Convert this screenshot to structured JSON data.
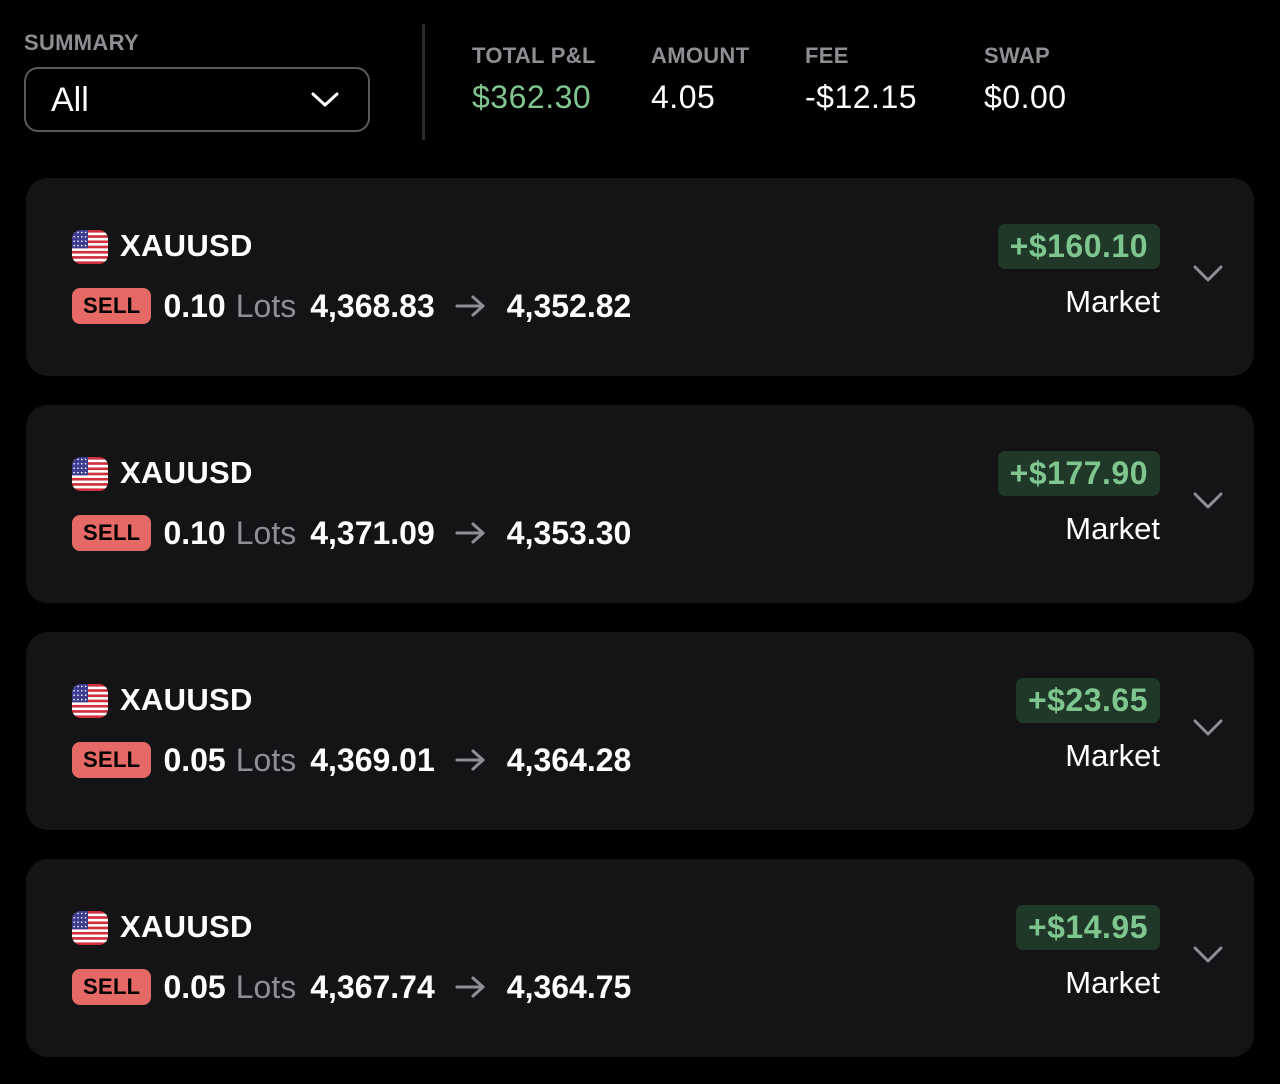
{
  "header": {
    "summary_label": "SUMMARY",
    "summary_selected": "All",
    "stats": {
      "total_pnl": {
        "label": "TOTAL P&L",
        "value": "$362.30"
      },
      "amount": {
        "label": "AMOUNT",
        "value": "4.05"
      },
      "fee": {
        "label": "FEE",
        "value": "-$12.15"
      },
      "swap": {
        "label": "SWAP",
        "value": "$0.00"
      }
    }
  },
  "positions": [
    {
      "symbol": "XAUUSD",
      "side": "SELL",
      "lots": "0.10",
      "lots_unit": "Lots",
      "open_price": "4,368.83",
      "close_price": "4,352.82",
      "pnl": "+$160.10",
      "order_type": "Market"
    },
    {
      "symbol": "XAUUSD",
      "side": "SELL",
      "lots": "0.10",
      "lots_unit": "Lots",
      "open_price": "4,371.09",
      "close_price": "4,353.30",
      "pnl": "+$177.90",
      "order_type": "Market"
    },
    {
      "symbol": "XAUUSD",
      "side": "SELL",
      "lots": "0.05",
      "lots_unit": "Lots",
      "open_price": "4,369.01",
      "close_price": "4,364.28",
      "pnl": "+$23.65",
      "order_type": "Market"
    },
    {
      "symbol": "XAUUSD",
      "side": "SELL",
      "lots": "0.05",
      "lots_unit": "Lots",
      "open_price": "4,367.74",
      "close_price": "4,364.75",
      "pnl": "+$14.95",
      "order_type": "Market"
    }
  ],
  "icons": {
    "flag": "us-flag-icon",
    "arrow": "arrow-right-icon",
    "expand": "chevron-down-icon"
  },
  "colors": {
    "background": "#000000",
    "card": "#141416",
    "positive": "#7fc58f",
    "positive_badge_bg": "#1f3828",
    "sell_badge": "#e56a66",
    "muted": "#8e8e93"
  }
}
